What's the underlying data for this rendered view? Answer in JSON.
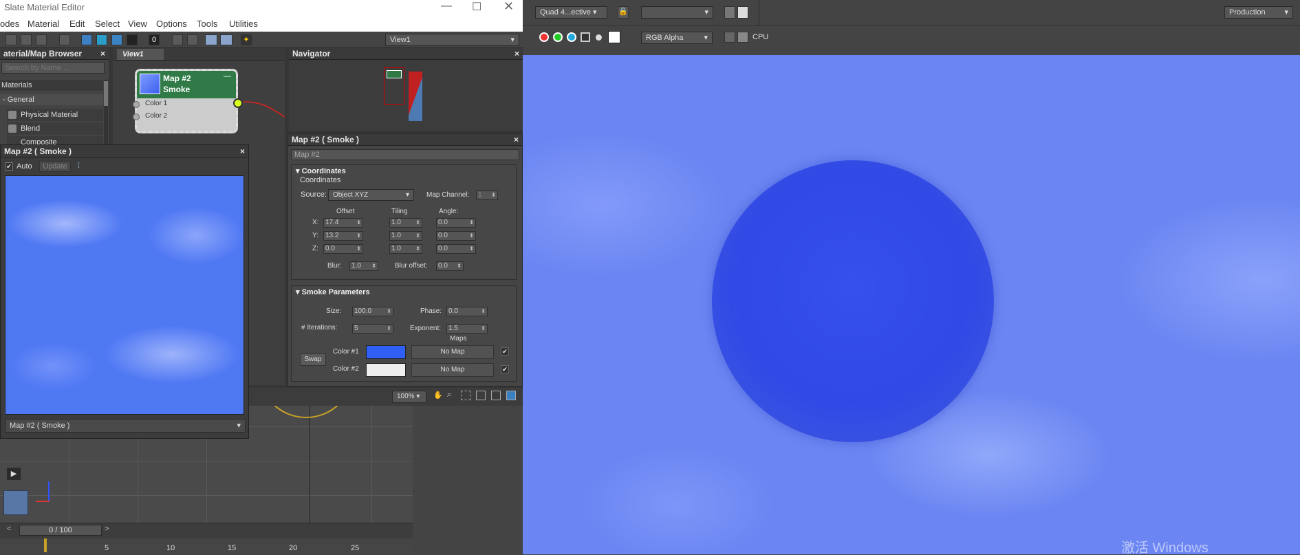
{
  "slate": {
    "title": "Slate Material Editor",
    "menu": [
      "odes",
      "Material",
      "Edit",
      "Select",
      "View",
      "Options",
      "Tools",
      "Utilities"
    ],
    "view_dropdown": "View1",
    "view_tab": "View1"
  },
  "browser": {
    "title": "aterial/Map Browser",
    "search_placeholder": "Search by Name ...",
    "section": "Materials",
    "group": "- General",
    "items": [
      "Physical Material",
      "Blend",
      "Composite"
    ]
  },
  "node": {
    "title_line1": "Map #2",
    "title_line2": "Smoke",
    "slot1": "Color 1",
    "slot2": "Color 2"
  },
  "navigator": {
    "title": "Navigator"
  },
  "preview": {
    "title": "Map #2  ( Smoke )",
    "auto_label": "Auto",
    "update_label": "Update",
    "footer_select": "Map #2  ( Smoke )"
  },
  "params": {
    "title": "Map #2  ( Smoke )",
    "name_field": "Map #2",
    "coordinates": {
      "header": "Coordinates",
      "sub": "Coordinates",
      "source_label": "Source:",
      "source_value": "Object XYZ",
      "map_channel_label": "Map Channel:",
      "map_channel_value": "1",
      "col_offset": "Offset",
      "col_tiling": "Tiling",
      "col_angle": "Angle:",
      "rows": [
        {
          "axis": "X:",
          "offset": "17.4",
          "tiling": "1.0",
          "angle": "0.0"
        },
        {
          "axis": "Y:",
          "offset": "13.2",
          "tiling": "1.0",
          "angle": "0.0"
        },
        {
          "axis": "Z:",
          "offset": "0.0",
          "tiling": "1.0",
          "angle": "0.0"
        }
      ],
      "blur_label": "Blur:",
      "blur_value": "1.0",
      "blur_offset_label": "Blur offset:",
      "blur_offset_value": "0.0"
    },
    "smoke": {
      "header": "Smoke Parameters",
      "size_label": "Size:",
      "size_value": "100.0",
      "phase_label": "Phase:",
      "phase_value": "0.0",
      "iterations_label": "# Iterations:",
      "iterations_value": "5",
      "exponent_label": "Exponent:",
      "exponent_value": "1.5",
      "maps_label": "Maps",
      "swap_label": "Swap",
      "color1_label": "Color #1",
      "color1": "#2f5ff5",
      "color2_label": "Color #2",
      "color2": "#efefef",
      "nomap1": "No Map",
      "nomap2": "No Map"
    },
    "zoom": "100%"
  },
  "render": {
    "viewport_select": "Quad 4...ective",
    "preset_select": "",
    "production_label": "Production",
    "channel_select": "RGB Alpha",
    "cpu_label": "CPU",
    "watermark": "激活 Windows"
  },
  "timeline": {
    "frame_display": "0 / 100",
    "ticks": [
      "5",
      "10",
      "15",
      "20",
      "25"
    ]
  }
}
